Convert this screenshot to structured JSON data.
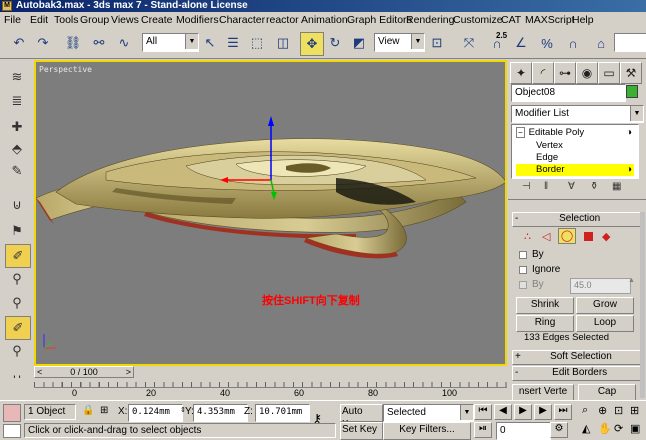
{
  "window": {
    "title": "Autobak3.max - 3ds max 7 - Stand-alone License"
  },
  "menu": [
    "File",
    "Edit",
    "Tools",
    "Group",
    "Views",
    "Create",
    "Modifiers",
    "Character",
    "reactor",
    "Animation",
    "Graph Editors",
    "Rendering",
    "Customize",
    "CAT",
    "MAXScript",
    "Help"
  ],
  "toolbar": {
    "selection_filter": "All",
    "ref_coord": "View",
    "spinner_value": "2.5"
  },
  "viewport": {
    "label": "Perspective",
    "annotation": "按住SHIFT向下复制"
  },
  "panel": {
    "object_name": "Object08",
    "object_color": "#3cb030",
    "modifier_list": "Modifier List",
    "stack": [
      "Editable Poly",
      "Vertex",
      "Edge",
      "Border"
    ],
    "stack_selected": "Border",
    "selection": {
      "title": "Selection",
      "by_vertex_label": "By",
      "ignore_backfacing_label": "Ignore",
      "angle_label": "By",
      "angle_value": "45.0",
      "shrink": "Shrink",
      "grow": "Grow",
      "ring": "Ring",
      "loop": "Loop",
      "status": "133 Edges Selected"
    },
    "soft_selection": {
      "sign": "+",
      "title": "Soft Selection"
    },
    "edit_borders": {
      "sign": "-",
      "title": "Edit Borders"
    },
    "insert_vertex": "nsert Verte",
    "cap": "Cap"
  },
  "timeline": {
    "frame": "0 / 100",
    "ticks": [
      "0",
      "20",
      "40",
      "60",
      "80",
      "100"
    ]
  },
  "status": {
    "selection_count": "1 Object",
    "x_label": "X:",
    "x": "0.124mm",
    "y_label": "Y:",
    "y": "4.353mm",
    "z_label": "Z:",
    "z": "10.701mm",
    "prompt": "Click or click-and-drag to select objects",
    "auto_key": "Auto Key",
    "set_key": "Set Key",
    "key_mode": "Selected",
    "key_filters": "Key Filters...",
    "current_frame": "0"
  }
}
